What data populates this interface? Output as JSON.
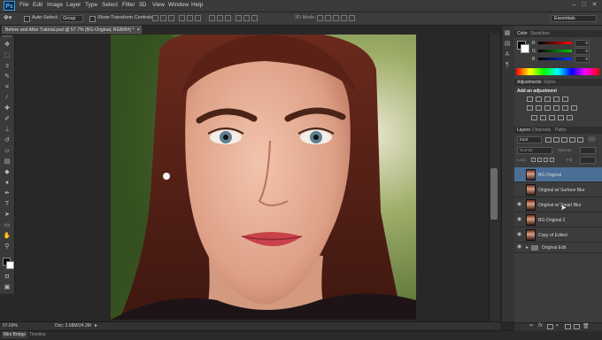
{
  "app": {
    "logo_text": "Ps"
  },
  "menu": [
    "File",
    "Edit",
    "Image",
    "Layer",
    "Type",
    "Select",
    "Filter",
    "3D",
    "View",
    "Window",
    "Help"
  ],
  "window_controls": [
    "–",
    "□",
    "✕"
  ],
  "options_bar": {
    "auto_select_label": "Auto-Select:",
    "auto_select_value": "Group",
    "show_transform_label": "Show Transform Controls",
    "mode_label": "3D Mode:",
    "workspace": "Essentials"
  },
  "document": {
    "tab_title": "Before and After Tutorial.psd @ 57.7% (BG-Original, RGB/8#) *",
    "close": "×",
    "zoom": "57.69%",
    "doc_size": "Doc: 2.68M/24.3M"
  },
  "bottom_tabs": [
    "Mini Bridge",
    "Timeline"
  ],
  "panels": {
    "color_tab": "Color",
    "swatches_tab": "Swatches",
    "color_values": {
      "R": "0",
      "G": "0",
      "B": "0"
    },
    "adjustments_tab": "Adjustments",
    "styles_tab": "Styles",
    "add_adjustment": "Add an adjustment",
    "layers_tab": "Layers",
    "channels_tab": "Channels",
    "paths_tab": "Paths",
    "kind_filter": "Kind",
    "blend_mode": "Normal",
    "opacity_label": "Opacity:",
    "lock_label": "Lock:",
    "fill_label": "Fill:"
  },
  "layers": [
    {
      "name": "BG-Original",
      "visible": false,
      "selected": true
    },
    {
      "name": "Original w/ Surface Blur",
      "visible": false,
      "selected": false
    },
    {
      "name": "Original w/ Smart Blur",
      "visible": true,
      "selected": false
    },
    {
      "name": "BG-Original 2",
      "visible": true,
      "selected": false
    },
    {
      "name": "Copy of Edited",
      "visible": true,
      "selected": false
    },
    {
      "name": "Original Edit",
      "visible": false,
      "selected": false,
      "is_group": true
    }
  ],
  "colors": {
    "accent_blue": "#1f6fb8",
    "panel_bg": "#3c3c3c",
    "selected_layer": "#4b6e96"
  }
}
